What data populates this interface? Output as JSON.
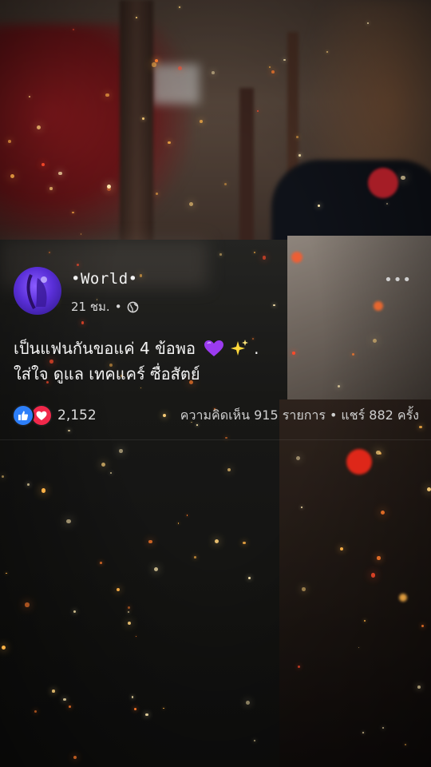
{
  "post": {
    "page_name": "•World•",
    "time": "21 ชม.",
    "separator": "•",
    "caption_line1": "เป็นแฟนกันขอแค่ 4 ข้อพอ",
    "caption_line1_end": ".",
    "caption_line2": "ใส่ใจ ดูแล เทคแคร์ ซื่อสัตย์",
    "more_label": "•••",
    "reaction_count": "2,152",
    "comments_text": "ความคิดเห็น 915 รายการ",
    "stats_separator": "•",
    "shares_text": "แชร์ 882 ครั้ง"
  },
  "icons": {
    "like": "like-icon",
    "love": "love-icon",
    "globe": "globe-icon",
    "heart_emoji": "purple-heart-icon",
    "sparkles_emoji": "sparkles-icon"
  },
  "colors": {
    "like": "#2d7ff9",
    "love": "#f0284a",
    "avatar": "#6a3cf0",
    "heart": "#9b3bf0"
  }
}
